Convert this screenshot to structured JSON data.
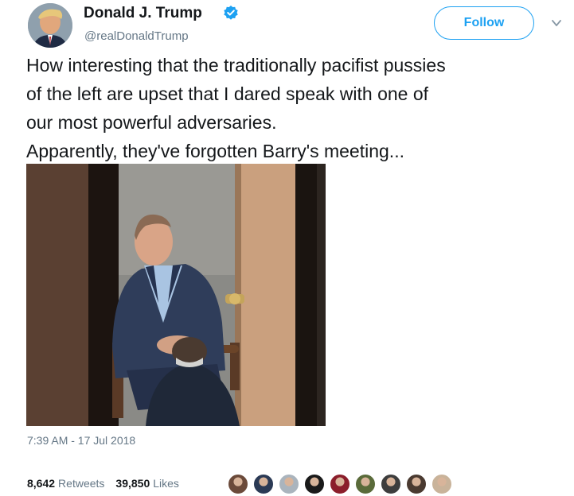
{
  "tweet": {
    "author_name": "Donald J. Trump",
    "author_handle": "@realDonaldTrump",
    "follow_label": "Follow",
    "text_lines": [
      "How interesting that the traditionally pacifist pussies",
      "of the left are upset that I dared speak with one of",
      "our most powerful adversaries.",
      "Apparently, they've forgotten Barry's meeting..."
    ],
    "timestamp": "7:39 AM - 17 Jul 2018",
    "retweets_count": "8,642",
    "retweets_label": "Retweets",
    "likes_count": "39,850",
    "likes_label": "Likes"
  },
  "icons": {
    "verified": "verified-badge-icon",
    "caret": "chevron-down-icon"
  },
  "colors": {
    "accent": "#1da1f2",
    "text": "#14171a",
    "muted": "#657786"
  },
  "liker_avatar_colors": [
    "#6b4a3a",
    "#2b3a55",
    "#aab4bd",
    "#1a1a1a",
    "#8b1e2b",
    "#5a6b3a",
    "#3d3d3d",
    "#4a3a30",
    "#c9b39a"
  ]
}
